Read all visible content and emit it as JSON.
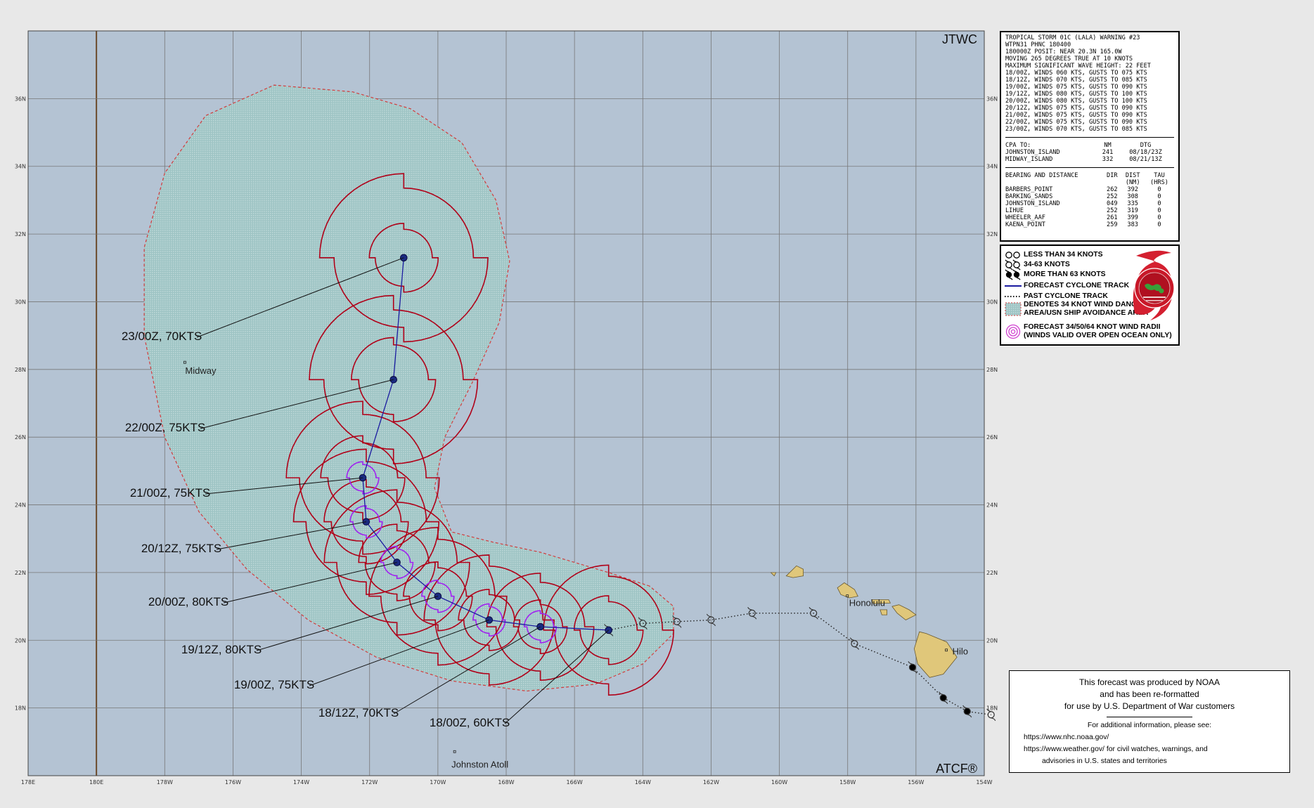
{
  "map": {
    "header_label": "JTWC",
    "footer_label": "ATCF®",
    "lon_ticks": [
      "178E",
      "180E",
      "178W",
      "176W",
      "174W",
      "172W",
      "170W",
      "168W",
      "166W",
      "164W",
      "162W",
      "160W",
      "158W",
      "156W",
      "154W"
    ],
    "lat_ticks": [
      "18N",
      "20N",
      "22N",
      "24N",
      "26N",
      "28N",
      "30N",
      "32N",
      "34N",
      "36N"
    ],
    "forecast_labels": [
      {
        "text": "23/00Z, 70KTS",
        "lon": -171.0,
        "lat": 31.3
      },
      {
        "text": "22/00Z, 75KTS",
        "lon": -171.3,
        "lat": 27.7
      },
      {
        "text": "21/00Z, 75KTS",
        "lon": -172.2,
        "lat": 24.8
      },
      {
        "text": "20/12Z, 75KTS",
        "lon": -172.1,
        "lat": 23.5
      },
      {
        "text": "20/00Z, 80KTS",
        "lon": -171.2,
        "lat": 22.3
      },
      {
        "text": "19/12Z, 80KTS",
        "lon": -170.0,
        "lat": 21.3
      },
      {
        "text": "19/00Z, 75KTS",
        "lon": -168.5,
        "lat": 20.6
      },
      {
        "text": "18/12Z, 70KTS",
        "lon": -167.0,
        "lat": 20.4
      },
      {
        "text": "18/00Z, 60KTS",
        "lon": -165.0,
        "lat": 20.3
      }
    ],
    "places": [
      {
        "name": "Midway",
        "lon": -177.4,
        "lat": 28.2
      },
      {
        "name": "Honolulu",
        "lon": -158.0,
        "lat": 21.3
      },
      {
        "name": "Hilo",
        "lon": -155.1,
        "lat": 19.7
      },
      {
        "name": "Johnston Atoll",
        "lon": -169.5,
        "lat": 16.7
      }
    ],
    "colors": {
      "ocean": "#b4c3d3",
      "danger": "#a8cccc",
      "radii": "#b00018",
      "wind_radii": "#a020f0",
      "track": "#1a1aa0",
      "land": "#e0c77a"
    }
  },
  "info": {
    "header_lines": [
      "TROPICAL STORM 01C (LALA) WARNING #23",
      "WTPN31 PHNC 180400",
      "180000Z POSIT: NEAR 20.3N 165.0W",
      "MOVING 265 DEGREES TRUE AT 10 KNOTS",
      "MAXIMUM SIGNIFICANT WAVE HEIGHT: 22 FEET"
    ],
    "forecast_lines": [
      "18/00Z, WINDS 060 KTS, GUSTS TO 075 KTS",
      "18/12Z, WINDS 070 KTS, GUSTS TO 085 KTS",
      "19/00Z, WINDS 075 KTS, GUSTS TO 090 KTS",
      "19/12Z, WINDS 080 KTS, GUSTS TO 100 KTS",
      "20/00Z, WINDS 080 KTS, GUSTS TO 100 KTS",
      "20/12Z, WINDS 075 KTS, GUSTS TO 090 KTS",
      "21/00Z, WINDS 075 KTS, GUSTS TO 090 KTS",
      "22/00Z, WINDS 075 KTS, GUSTS TO 090 KTS",
      "23/00Z, WINDS 070 KTS, GUSTS TO 085 KTS"
    ],
    "cpa_header": [
      "CPA TO:",
      "NM",
      "DTG"
    ],
    "cpa_rows": [
      [
        "JOHNSTON_ISLAND",
        "241",
        "08/18/23Z"
      ],
      [
        "MIDWAY_ISLAND",
        "332",
        "08/21/13Z"
      ]
    ],
    "bd_header": [
      "BEARING AND DISTANCE",
      "DIR",
      "DIST",
      "TAU"
    ],
    "bd_subheader": [
      "",
      "",
      "(NM)",
      "(HRS)"
    ],
    "bd_rows": [
      [
        "BARBERS_POINT",
        "262",
        "392",
        "0"
      ],
      [
        "BARKING_SANDS",
        "252",
        "308",
        "0"
      ],
      [
        "JOHNSTON_ISLAND",
        "049",
        "335",
        "0"
      ],
      [
        "LIHUE",
        "252",
        "319",
        "0"
      ],
      [
        "WHEELER_AAF",
        "261",
        "399",
        "0"
      ],
      [
        "KAENA_POINT",
        "259",
        "383",
        "0"
      ]
    ]
  },
  "legend": {
    "items": [
      "LESS THAN 34 KNOTS",
      "34-63 KNOTS",
      "MORE THAN 63 KNOTS",
      "FORECAST CYCLONE TRACK",
      "PAST CYCLONE TRACK",
      "DENOTES 34 KNOT WIND DANGER AREA/USN SHIP AVOIDANCE AREA",
      "FORECAST 34/50/64 KNOT WIND RADII (WINDS VALID OVER OPEN OCEAN ONLY)"
    ]
  },
  "credit": {
    "line1": "This forecast was produced by NOAA",
    "line2": "and has been re-formatted",
    "line3": "for use by U.S. Department of War customers",
    "info": "For additional information, please see:",
    "link1": "https://www.nhc.noaa.gov/",
    "link2_url": "https://www.weather.gov/",
    "link2_text": " for civil watches, warnings, and",
    "link2_cont": "advisories in U.S. states and territories"
  }
}
